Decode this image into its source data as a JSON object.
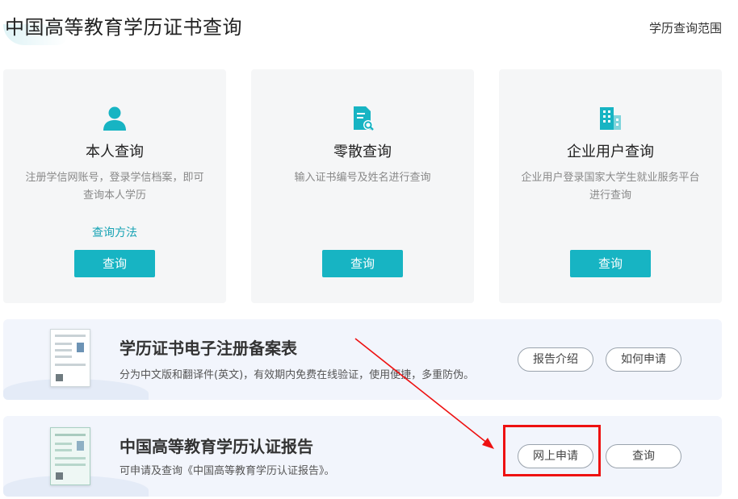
{
  "header": {
    "title": "中国高等教育学历证书查询",
    "scope_link": "学历查询范围"
  },
  "cards": [
    {
      "icon": "person-icon",
      "title": "本人查询",
      "desc": "注册学信网账号，登录学信档案，即可查询本人学历",
      "link": "查询方法",
      "button": "查询"
    },
    {
      "icon": "document-search-icon",
      "title": "零散查询",
      "desc": "输入证书编号及姓名进行查询",
      "link": "",
      "button": "查询"
    },
    {
      "icon": "building-icon",
      "title": "企业用户查询",
      "desc": "企业用户登录国家大学生就业服务平台进行查询",
      "link": "",
      "button": "查询"
    }
  ],
  "bands": [
    {
      "title": "学历证书电子注册备案表",
      "subtitle": "分为中文版和翻译件(英文)，有效期内免费在线验证，使用便捷，多重防伪。",
      "buttons": [
        "报告介绍",
        "如何申请"
      ]
    },
    {
      "title": "中国高等教育学历认证报告",
      "subtitle": "可申请及查询《中国高等教育学历认证报告》。",
      "buttons": [
        "网上申请",
        "查询"
      ]
    }
  ],
  "colors": {
    "accent": "#17b4c3",
    "link": "#16a3b4",
    "annotation": "#ee1111",
    "card_bg": "#f5f6f7",
    "band_bg": "#f2f5fc"
  }
}
